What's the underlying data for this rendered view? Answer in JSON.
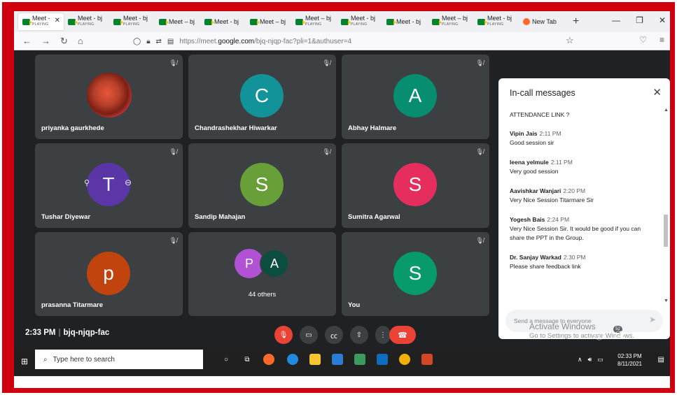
{
  "browser": {
    "tabs": [
      {
        "title": "Meet - ",
        "sub": "PLAYING",
        "active": true
      },
      {
        "title": "Meet - bj",
        "sub": "PLAYING"
      },
      {
        "title": "Meet - bj",
        "sub": "PLAYING"
      },
      {
        "title": "Meet – bj",
        "sub": ""
      },
      {
        "title": "Meet - bj",
        "sub": ""
      },
      {
        "title": "Meet – bj",
        "sub": ""
      },
      {
        "title": "Meet – bj",
        "sub": "PLAYING"
      },
      {
        "title": "Meet - bj",
        "sub": "PLAYING"
      },
      {
        "title": "Meet - bj",
        "sub": ""
      },
      {
        "title": "Meet – bj",
        "sub": "PLAYING"
      },
      {
        "title": "Meet - bj",
        "sub": "PLAYING"
      }
    ],
    "new_tab_label": "New Tab",
    "url_prefix": "https://meet.",
    "url_domain": "google.com",
    "url_path": "/bjq-njqp-fac?pli=1&authuser=4"
  },
  "participants": [
    {
      "name": "priyanka gaurkhede",
      "initial": "",
      "color": "#c0392b"
    },
    {
      "name": "Chandrashekhar Hiwarkar",
      "initial": "C",
      "color": "#12939a"
    },
    {
      "name": "Abhay Halmare",
      "initial": "A",
      "color": "#078d6f"
    },
    {
      "name": "Tushar Diyewar",
      "initial": "T",
      "color": "#5e35b1"
    },
    {
      "name": "Sandip Mahajan",
      "initial": "S",
      "color": "#689f38"
    },
    {
      "name": "Sumitra Agarwal",
      "initial": "S",
      "color": "#e52d5e"
    },
    {
      "name": "prasanna Titarmare",
      "initial": "p",
      "color": "#c1440e"
    },
    {
      "name": "44 others",
      "initial": "P",
      "initial2": "A",
      "color": "#b052d3",
      "color2": "#0b4d3f"
    },
    {
      "name": "You",
      "initial": "S",
      "color": "#079a6b"
    }
  ],
  "chat": {
    "title": "In-call messages",
    "first_line": "ATTENDANCE LINK ?",
    "messages": [
      {
        "sender": "Vipin Jais",
        "time": "2:11 PM",
        "text": "Good session sir"
      },
      {
        "sender": "leena yelmule",
        "time": "2:11 PM",
        "text": "Very good session"
      },
      {
        "sender": "Aavishkar Wanjari",
        "time": "2:20 PM",
        "text": "Very Nice Session Titarmare Sir"
      },
      {
        "sender": "Yogesh Bais",
        "time": "2:24 PM",
        "text": "Very Nice Session Sir. It would be good if  you can share the PPT in the Group."
      },
      {
        "sender": "Dr. Sanjay Warkad",
        "time": "2:30 PM",
        "text": "Please share feedback link"
      }
    ],
    "placeholder": "Send a message to everyone"
  },
  "meeting": {
    "time": "2:33 PM",
    "separator": "|",
    "code": "bjq-njqp-fac",
    "people_count": "52"
  },
  "watermark": {
    "line1": "Activate Windows",
    "line2": "Go to Settings to activate Windows."
  },
  "taskbar": {
    "search_placeholder": "Type here to search",
    "time": "02:33 PM",
    "date": "8/11/2021"
  }
}
